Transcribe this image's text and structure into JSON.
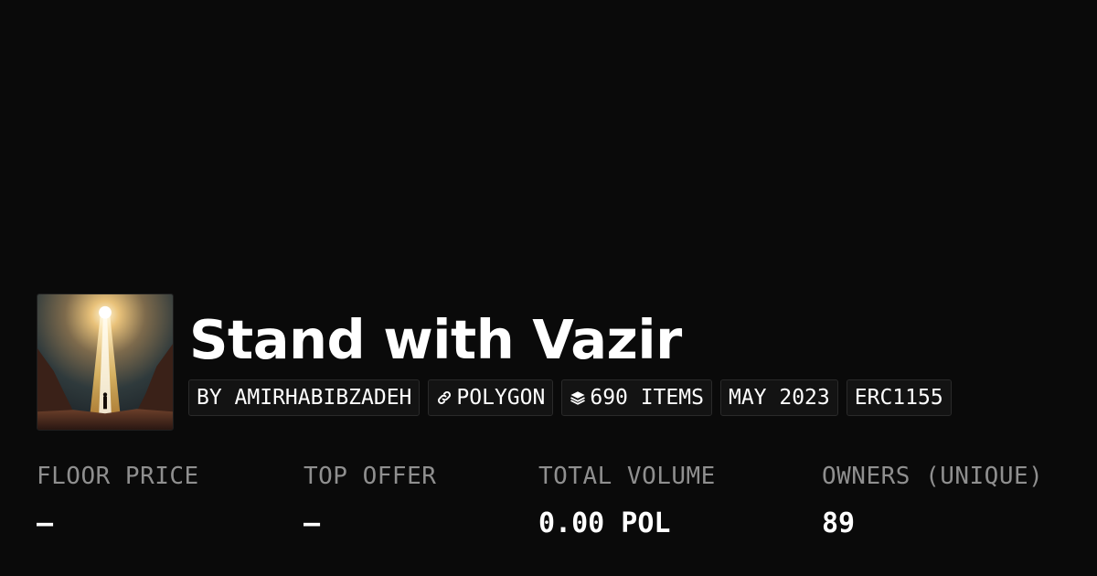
{
  "collection": {
    "title": "Stand with Vazir",
    "image_alt": "collection-thumbnail"
  },
  "tags": [
    {
      "label": "BY AMIRHABIBZADEH",
      "icon": ""
    },
    {
      "label": "POLYGON",
      "icon": "link-icon"
    },
    {
      "label": "690 ITEMS",
      "icon": "layers-icon"
    },
    {
      "label": "MAY 2023",
      "icon": ""
    },
    {
      "label": "ERC1155",
      "icon": ""
    }
  ],
  "stats": [
    {
      "label": "FLOOR PRICE",
      "value": "–"
    },
    {
      "label": "TOP OFFER",
      "value": "–"
    },
    {
      "label": "TOTAL VOLUME",
      "value": "0.00 POL"
    },
    {
      "label": "OWNERS (UNIQUE)",
      "value": "89"
    }
  ],
  "colors": {
    "background": "#0a0a0a",
    "text": "#ffffff",
    "muted": "#8f8f8f",
    "tag_border": "#2a2a2a"
  }
}
